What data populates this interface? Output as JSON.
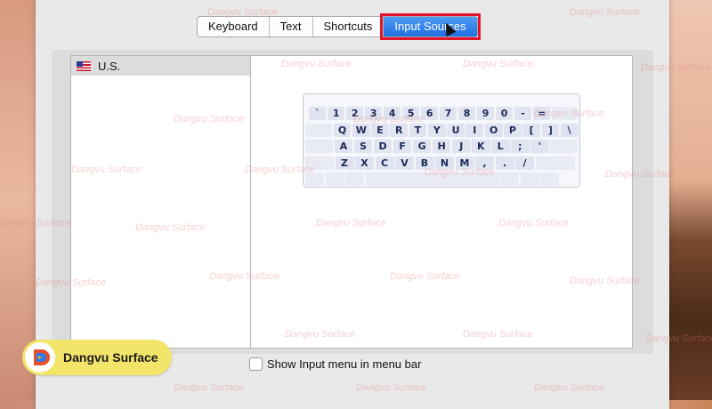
{
  "tabs": [
    {
      "label": "Keyboard"
    },
    {
      "label": "Text"
    },
    {
      "label": "Shortcuts"
    },
    {
      "label": "Input Sources"
    }
  ],
  "selected_tab": "Input Sources",
  "input_sources": [
    {
      "label": "U.S.",
      "icon": "us-flag-icon"
    }
  ],
  "keyboard": {
    "row1": [
      "`",
      "1",
      "2",
      "3",
      "4",
      "5",
      "6",
      "7",
      "8",
      "9",
      "0",
      "-",
      "="
    ],
    "row2": [
      "Q",
      "W",
      "E",
      "R",
      "T",
      "Y",
      "U",
      "I",
      "O",
      "P",
      "[",
      "]",
      "\\"
    ],
    "row3": [
      "A",
      "S",
      "D",
      "F",
      "G",
      "H",
      "J",
      "K",
      "L",
      ";",
      "'"
    ],
    "row4": [
      "Z",
      "X",
      "C",
      "V",
      "B",
      "N",
      "M",
      ",",
      ".",
      "/"
    ]
  },
  "checkbox": {
    "label": "Show Input menu in menu bar",
    "checked": false
  },
  "add_button_label": "+",
  "watermark": {
    "text": "Dangvu Surface"
  },
  "badge": {
    "text": "Dangvu Surface"
  },
  "colors": {
    "selected_tab": "#1f6fe0",
    "highlight_outline": "#e3142b",
    "badge_bg": "#f3e56a"
  }
}
